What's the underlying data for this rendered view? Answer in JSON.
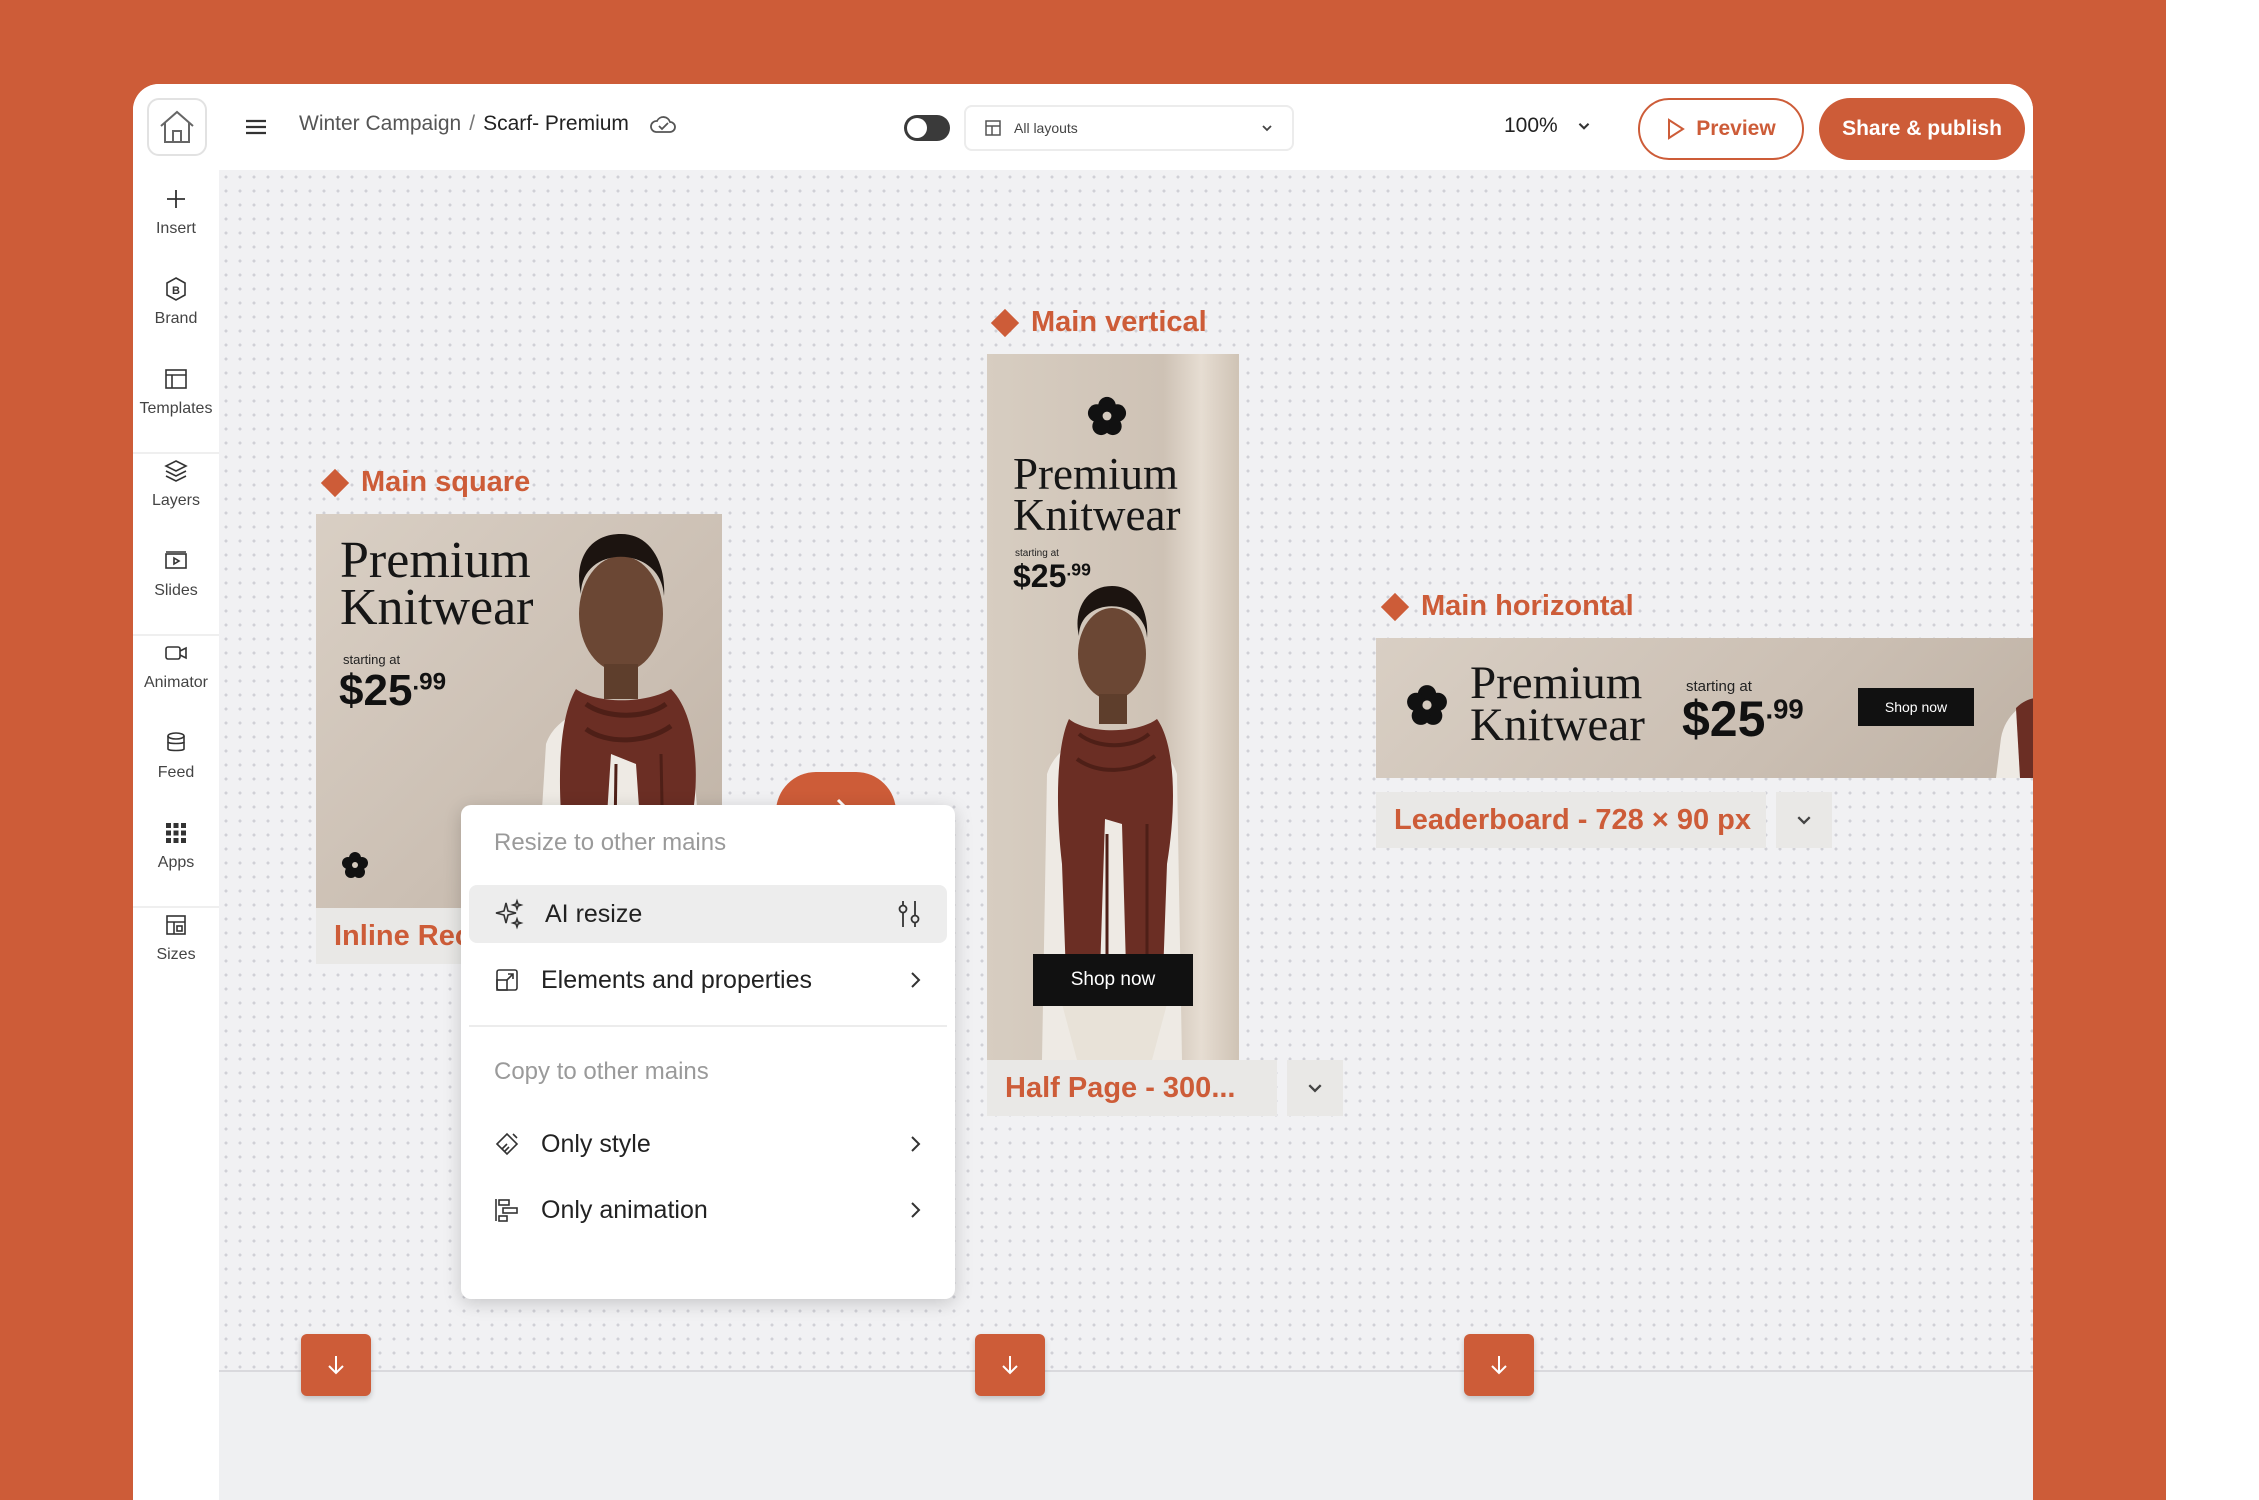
{
  "topbar": {
    "breadcrumb": [
      "Winter Campaign",
      "/",
      "Scarf- Premium"
    ],
    "layout_select": "All layouts",
    "zoom": "100%",
    "preview_label": "Preview",
    "publish_label": "Share & publish"
  },
  "sidebar": {
    "items": [
      {
        "label": "Insert",
        "icon": "plus-icon"
      },
      {
        "label": "Brand",
        "icon": "brand-icon"
      },
      {
        "label": "Templates",
        "icon": "templates-icon"
      },
      {
        "label": "Layers",
        "icon": "layers-icon"
      },
      {
        "label": "Slides",
        "icon": "slides-icon"
      },
      {
        "label": "Animator",
        "icon": "animator-icon"
      },
      {
        "label": "Feed",
        "icon": "feed-icon"
      },
      {
        "label": "Apps",
        "icon": "apps-icon"
      },
      {
        "label": "Sizes",
        "icon": "sizes-icon"
      }
    ]
  },
  "canvas": {
    "square": {
      "title": "Main square",
      "headline1": "Premium",
      "headline2": "Knitwear",
      "starting": "starting at",
      "price": "$25",
      "cents": ".99",
      "size_label": "Inline Rectangle"
    },
    "vertical": {
      "title": "Main vertical",
      "headline1": "Premium",
      "headline2": "Knitwear",
      "starting": "starting at",
      "price": "$25",
      "cents": ".99",
      "cta": "Shop now",
      "size_label": "Half Page - 300..."
    },
    "horizontal": {
      "title": "Main horizontal",
      "headline1": "Premium",
      "headline2": "Knitwear",
      "starting": "starting at",
      "price": "$25",
      "cents": ".99",
      "cta": "Shop now",
      "size_label": "Leaderboard - 728 × 90 px"
    }
  },
  "menu": {
    "resize_heading": "Resize to other mains",
    "ai_resize": "AI resize",
    "elements_properties": "Elements and properties",
    "copy_heading": "Copy to other mains",
    "only_style": "Only style",
    "only_animation": "Only animation"
  },
  "colors": {
    "accent": "#cd5c38",
    "canvas_bg": "#f1f1f3",
    "banner_bg": "#d4c9bd",
    "scarf": "#6b2e24"
  }
}
